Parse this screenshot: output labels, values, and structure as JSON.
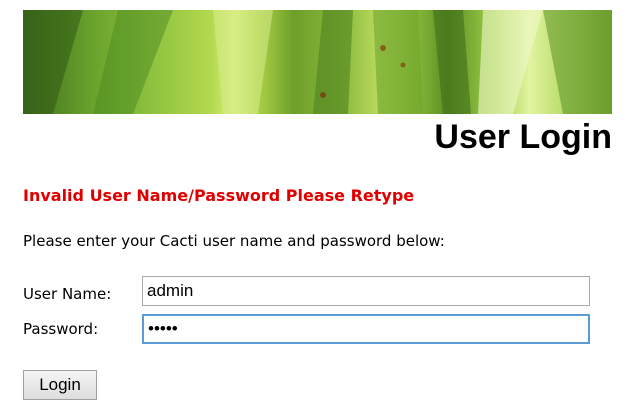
{
  "header": {
    "title": "User Login"
  },
  "messages": {
    "error": "Invalid User Name/Password Please Retype",
    "instructions": "Please enter your Cacti user name and password below:"
  },
  "form": {
    "username_label": "User Name:",
    "username_value": "admin",
    "password_label": "Password:",
    "password_value": "•••••",
    "login_label": "Login"
  },
  "colors": {
    "error": "#e00000",
    "focus_border": "#5b9bd5"
  }
}
